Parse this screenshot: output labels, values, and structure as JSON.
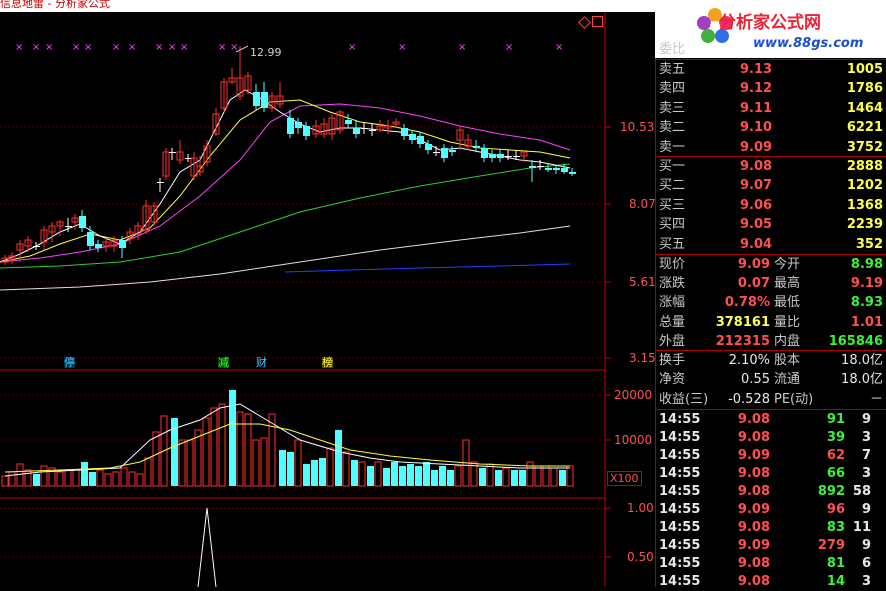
{
  "window_title": "信息地雷 - 分析家公式",
  "logo": {
    "title": "分析家公式网",
    "url": "www.88gs.com"
  },
  "price_chart": {
    "max_price_label": "12.99",
    "axis_ticks": [
      "10.53",
      "8.07",
      "5.61",
      "3.15"
    ],
    "event_tags": [
      "停",
      "减",
      "财",
      "榜"
    ]
  },
  "volume_chart": {
    "axis_ticks": [
      "20000",
      "10000"
    ],
    "unit": "X100"
  },
  "indicator_chart": {
    "axis_ticks": [
      "1.00",
      "0.50"
    ]
  },
  "order_book": {
    "header": "委比",
    "asks": [
      {
        "label": "卖五",
        "price": "9.13",
        "vol": "1005"
      },
      {
        "label": "卖四",
        "price": "9.12",
        "vol": "1786"
      },
      {
        "label": "卖三",
        "price": "9.11",
        "vol": "1464"
      },
      {
        "label": "卖二",
        "price": "9.10",
        "vol": "6221"
      },
      {
        "label": "卖一",
        "price": "9.09",
        "vol": "3752"
      }
    ],
    "bids": [
      {
        "label": "买一",
        "price": "9.08",
        "vol": "2888"
      },
      {
        "label": "买二",
        "price": "9.07",
        "vol": "1202"
      },
      {
        "label": "买三",
        "price": "9.06",
        "vol": "1368"
      },
      {
        "label": "买四",
        "price": "9.05",
        "vol": "2239"
      },
      {
        "label": "买五",
        "price": "9.04",
        "vol": "352"
      }
    ]
  },
  "quote": [
    {
      "l1": "现价",
      "v1": "9.09",
      "c1": "red",
      "l2": "今开",
      "v2": "8.98",
      "c2": "grn"
    },
    {
      "l1": "涨跌",
      "v1": "0.07",
      "c1": "red",
      "l2": "最高",
      "v2": "9.19",
      "c2": "red"
    },
    {
      "l1": "涨幅",
      "v1": "0.78%",
      "c1": "red",
      "l2": "最低",
      "v2": "8.93",
      "c2": "grn"
    },
    {
      "l1": "总量",
      "v1": "378161",
      "c1": "yel",
      "l2": "量比",
      "v2": "1.01",
      "c2": "red"
    },
    {
      "l1": "外盘",
      "v1": "212315",
      "c1": "red",
      "l2": "内盘",
      "v2": "165846",
      "c2": "grn"
    }
  ],
  "fundamentals": [
    {
      "l1": "换手",
      "v1": "2.10%",
      "l2": "股本",
      "v2": "18.0亿"
    },
    {
      "l1": "净资",
      "v1": "0.55",
      "l2": "流通",
      "v2": "18.0亿"
    },
    {
      "l1": "收益(三)",
      "v1": "-0.528",
      "l2": "PE(动)",
      "v2": "－"
    }
  ],
  "ticks": [
    {
      "time": "14:55",
      "price": "9.08",
      "pc": "red",
      "vol": "91",
      "vc": "grn",
      "n": "9"
    },
    {
      "time": "14:55",
      "price": "9.08",
      "pc": "red",
      "vol": "39",
      "vc": "grn",
      "n": "3"
    },
    {
      "time": "14:55",
      "price": "9.09",
      "pc": "red",
      "vol": "62",
      "vc": "red",
      "n": "7"
    },
    {
      "time": "14:55",
      "price": "9.08",
      "pc": "red",
      "vol": "66",
      "vc": "grn",
      "n": "3"
    },
    {
      "time": "14:55",
      "price": "9.08",
      "pc": "red",
      "vol": "892",
      "vc": "grn",
      "n": "58"
    },
    {
      "time": "14:55",
      "price": "9.09",
      "pc": "red",
      "vol": "96",
      "vc": "red",
      "n": "9"
    },
    {
      "time": "14:55",
      "price": "9.08",
      "pc": "red",
      "vol": "83",
      "vc": "grn",
      "n": "11"
    },
    {
      "time": "14:55",
      "price": "9.09",
      "pc": "red",
      "vol": "279",
      "vc": "red",
      "n": "9"
    },
    {
      "time": "14:55",
      "price": "9.08",
      "pc": "red",
      "vol": "81",
      "vc": "grn",
      "n": "6"
    },
    {
      "time": "14:55",
      "price": "9.08",
      "pc": "red",
      "vol": "14",
      "vc": "grn",
      "n": "3"
    }
  ],
  "colors": {
    "up": "#ff3030",
    "down": "#50ffff",
    "axis": "#c00000",
    "ma5": "#ffffff",
    "ma10": "#ffff40",
    "ma20": "#ff40ff",
    "ma60": "#30d030",
    "ma120": "#e0e0e0",
    "ma250": "#2040ff"
  }
}
